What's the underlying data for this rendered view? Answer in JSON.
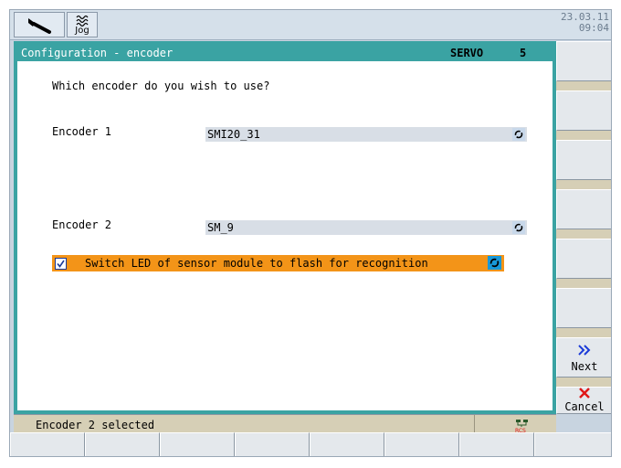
{
  "header": {
    "operating_area_icon": "wrench-icon",
    "mode_icon": "jog-icon",
    "mode_label": "Jog",
    "date": "23.03.11",
    "time": "09:04"
  },
  "dialog": {
    "title": "Configuration - encoder",
    "channel_label": "SERVO",
    "channel_number": "5",
    "question": "Which encoder do you wish to use?",
    "encoder1": {
      "label": "Encoder 1",
      "value": "SMI20_31"
    },
    "encoder2": {
      "label": "Encoder 2",
      "value": "SM_9"
    },
    "led_option": {
      "label": "Switch LED of sensor module to flash for recognition",
      "checked": true
    }
  },
  "status": {
    "message": "Encoder 2 selected",
    "icon": "rcs-network-icon"
  },
  "softkeys_vertical": [
    {
      "label": ""
    },
    {
      "label": ""
    },
    {
      "label": ""
    },
    {
      "label": ""
    },
    {
      "label": ""
    },
    {
      "label": ""
    },
    {
      "label": "Next",
      "icon": "chevron-right-icon"
    },
    {
      "label": "Cancel",
      "icon": "close-icon"
    }
  ],
  "colors": {
    "dialog_frame": "#3aa3a3",
    "highlight": "#f39418",
    "toggle_blue": "#1898d8",
    "next_blue": "#1a3ad8",
    "cancel_red": "#e01818"
  }
}
